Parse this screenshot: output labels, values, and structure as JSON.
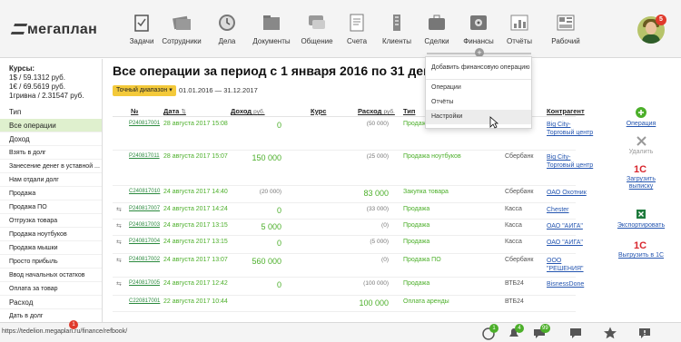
{
  "app": {
    "logo_text": "мегаплан",
    "avatar_badge": "5"
  },
  "nav": [
    {
      "label": "Задачи",
      "icon": "tasks-icon"
    },
    {
      "label": "Сотрудники",
      "icon": "employees-icon"
    },
    {
      "label": "Дела",
      "icon": "clock-icon"
    },
    {
      "label": "Документы",
      "icon": "documents-icon"
    },
    {
      "label": "Общение",
      "icon": "chat-icon"
    },
    {
      "label": "Счета",
      "icon": "invoices-icon"
    },
    {
      "label": "Клиенты",
      "icon": "clients-icon"
    },
    {
      "label": "Сделки",
      "icon": "deals-icon"
    },
    {
      "label": "Финансы",
      "icon": "safe-icon"
    },
    {
      "label": "Отчёты",
      "icon": "reports-icon"
    },
    {
      "label": "Рабочий",
      "icon": "workspace-icon"
    }
  ],
  "sidebar": {
    "rates_title": "Курсы:",
    "rates": [
      "1$ / 59.1312 руб.",
      "1€ / 69.5619 руб.",
      "1гривна / 2.31547 руб."
    ],
    "type_label": "Тип",
    "all_ops": "Все операции",
    "income_label": "Доход",
    "income_items": [
      "Взять в долг",
      "Занесение денег в уставной ...",
      "Нам отдали долг",
      "Продажа",
      "Продажа ПО",
      "Отгрузка товара",
      "Продажа ноутбуков",
      "Продажа мышки",
      "Просто прибыль",
      "Ввод начальных остатков",
      "Оплата за товар"
    ],
    "expense_label": "Расход",
    "expense_items": [
      "Дать в долг"
    ]
  },
  "main": {
    "title": "Все операции за период с 1 января 2016 по 31 декабр",
    "period_badge": "Точный диапазон",
    "dates": "01.01.2016 — 31.12.2017"
  },
  "table": {
    "headers": {
      "num": "№",
      "date": "Дата",
      "income": "Доход",
      "income_unit": "руб.",
      "rate": "Курс",
      "expense": "Расход",
      "expense_unit": "руб.",
      "type": "Тип",
      "contractor": "Контрагент"
    },
    "rows": [
      {
        "num": "P240817001",
        "date": "28 августа 2017 15:08",
        "income": "0",
        "expense": "(50 000)",
        "type": "Продажа",
        "account": "",
        "contractor": "Big City-Торговый центр",
        "repeat": false
      },
      {
        "num": "P240817011",
        "date": "28 августа 2017 15:07",
        "income": "150 000",
        "expense": "(25 000)",
        "type": "Продажа ноутбуков",
        "account": "Сбербанк",
        "contractor": "Big City-Торговый центр",
        "repeat": false
      },
      {
        "num": "C240817010",
        "date": "24 августа 2017 14:40",
        "income": "(20 000)",
        "expense": "83 000",
        "type": "Закупка товара",
        "account": "Сбербанк",
        "contractor": "ОАО Охотник",
        "repeat": false
      },
      {
        "num": "P240817007",
        "date": "24 августа 2017 14:24",
        "income": "0",
        "expense": "(33 000)",
        "type": "Продажа",
        "account": "Касса",
        "contractor": "Chester",
        "repeat": true
      },
      {
        "num": "P240817003",
        "date": "24 августа 2017 13:15",
        "income": "5 000",
        "expense": "(0)",
        "type": "Продажа",
        "account": "Касса",
        "contractor": "ОАО \"АИГА\"",
        "repeat": true
      },
      {
        "num": "P240817004",
        "date": "24 августа 2017 13:15",
        "income": "0",
        "expense": "(5 000)",
        "type": "Продажа",
        "account": "Касса",
        "contractor": "ОАО \"АИГА\"",
        "repeat": true
      },
      {
        "num": "P240817002",
        "date": "24 августа 2017 13:07",
        "income": "560 000",
        "expense": "(0)",
        "type": "Продажа ПО",
        "account": "Сбербанк",
        "contractor": "ООО \"РЕШЕНИЯ\"",
        "repeat": true
      },
      {
        "num": "P240817005",
        "date": "24 августа 2017 12:42",
        "income": "0",
        "expense": "(100 000)",
        "type": "Продажа",
        "account": "ВТБ24",
        "contractor": "BisnessDone",
        "repeat": true
      },
      {
        "num": "C220817001",
        "date": "22 августа 2017 10:44",
        "income": "",
        "expense": "100 000",
        "type": "Оплата аренды",
        "account": "ВТБ24",
        "contractor": "",
        "repeat": false
      }
    ]
  },
  "actions": [
    {
      "label": "Операция",
      "icon": "plus-circle-icon",
      "enabled": true
    },
    {
      "label": "Удалить",
      "icon": "delete-x-icon",
      "enabled": false
    },
    {
      "label": "Загрузить выписку",
      "icon": "1c-icon",
      "enabled": true
    },
    {
      "label": "Экспортировать",
      "icon": "excel-icon",
      "enabled": true
    },
    {
      "label": "Выгрузить в 1С",
      "icon": "1c-export-icon",
      "enabled": true
    }
  ],
  "dropdown": {
    "items": [
      "Добавить финансовую операцию",
      "Операции",
      "Отчёты",
      "Настройки"
    ]
  },
  "bottom": {
    "status_url": "https://tedelion.megaplan.ru/finance/refbook/",
    "badges": [
      "1",
      "4",
      "99"
    ],
    "bottom_badge_red": "1"
  },
  "colors": {
    "accent_green": "#4caf2a",
    "link_green": "#2b8a3e",
    "link_blue": "#2455b0",
    "period_badge": "#f3c93a",
    "selected_bg": "#dff0ce"
  }
}
